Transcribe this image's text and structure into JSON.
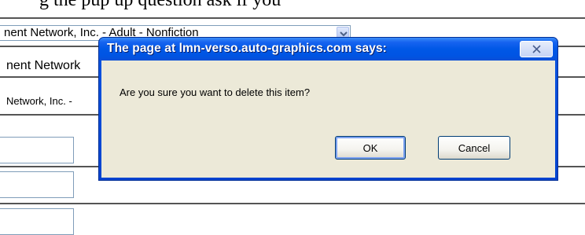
{
  "page": {
    "heading_partial": "g the                  pup up question  ask if you",
    "select_value": "nent Network, Inc. - Adult - Nonfiction",
    "text_line_1": "nent Network",
    "text_line_2": "Network, Inc. -"
  },
  "dialog": {
    "title": "The page at lmn-verso.auto-graphics.com says:",
    "message": "Are you sure you want to delete this item?",
    "ok_label": "OK",
    "cancel_label": "Cancel",
    "close_icon": "close-icon"
  },
  "colors": {
    "titlebar": "#0054e3",
    "client": "#ece9d8",
    "button_focus": "#7ba1f0"
  }
}
